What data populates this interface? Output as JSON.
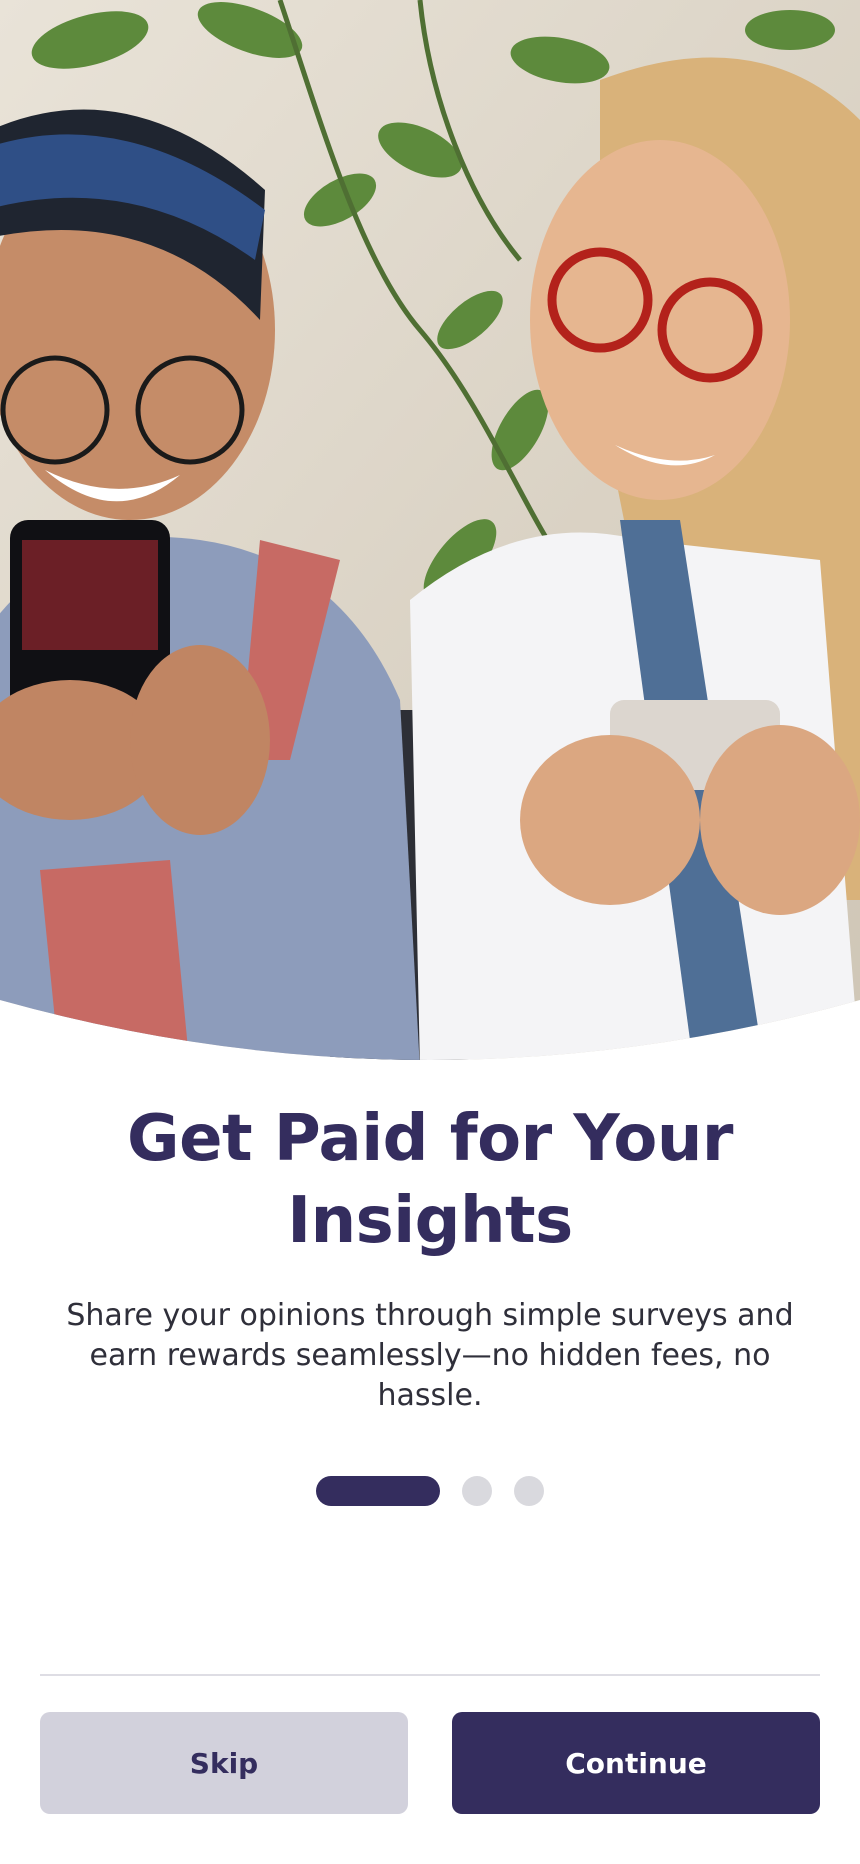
{
  "onboarding": {
    "title": "Get Paid for Your Insights",
    "subtitle": "Share your opinions through simple surveys and earn rewards seamlessly—no hidden fees, no hassle.",
    "pagination": {
      "current": 1,
      "total": 3
    }
  },
  "actions": {
    "skip_label": "Skip",
    "continue_label": "Continue"
  },
  "colors": {
    "primary": "#342d5e",
    "secondary_button": "#d2d1dc",
    "inactive_dot": "#d9d9de",
    "background": "#ffffff"
  }
}
